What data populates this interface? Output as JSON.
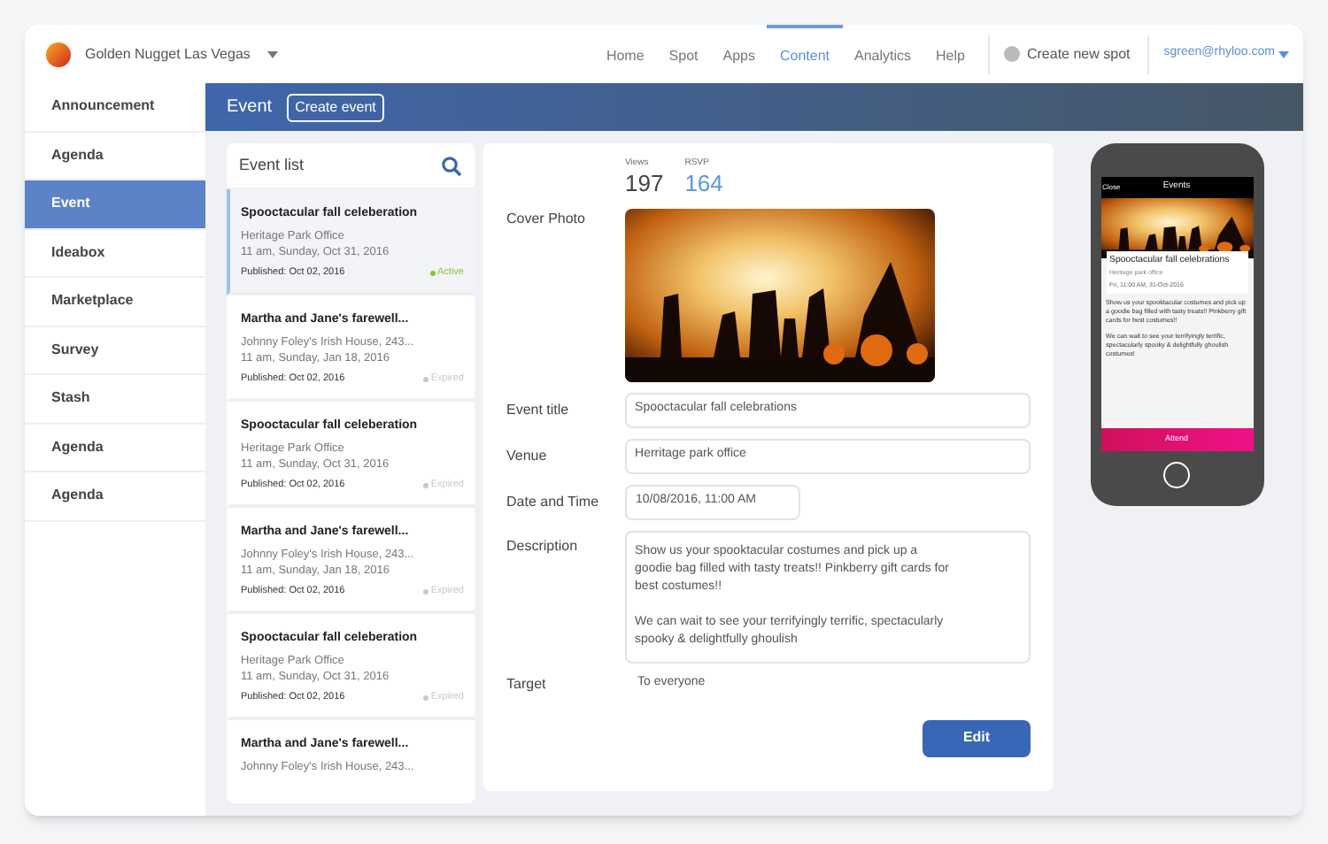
{
  "brand": {
    "name": "Golden Nugget Las Vegas"
  },
  "nav": [
    {
      "label": "Home",
      "selected": false
    },
    {
      "label": "Spot",
      "selected": false
    },
    {
      "label": "Apps",
      "selected": false
    },
    {
      "label": "Content",
      "selected": true
    },
    {
      "label": "Analytics",
      "selected": false
    },
    {
      "label": "Help",
      "selected": false
    }
  ],
  "create_spot": "Create new spot",
  "user": "sgreen@rhyloo.com",
  "sidebar": {
    "items": [
      {
        "label": "Announcement",
        "selected": false
      },
      {
        "label": "Agenda",
        "selected": false
      },
      {
        "label": "Event",
        "selected": true
      },
      {
        "label": "Ideabox",
        "selected": false
      },
      {
        "label": "Marketplace",
        "selected": false
      },
      {
        "label": "Survey",
        "selected": false
      },
      {
        "label": "Stash",
        "selected": false
      },
      {
        "label": "Agenda",
        "selected": false
      },
      {
        "label": "Agenda",
        "selected": false
      }
    ]
  },
  "header": {
    "title": "Event",
    "button": "Create event"
  },
  "event_list": {
    "title": "Event list",
    "items": [
      {
        "title": "Spooctacular fall celeberation",
        "venue": "Heritage Park Office",
        "time": "11 am, Sunday, Oct 31, 2016",
        "published": "Published: Oct 02, 2016",
        "status": "Active",
        "active": true,
        "selected": true
      },
      {
        "title": "Martha and Jane's farewell...",
        "venue": "Johnny Foley's Irish House, 243...",
        "time": "11 am, Sunday, Jan 18, 2016",
        "published": "Published: Oct 02, 2016",
        "status": "Expired",
        "active": false,
        "selected": false
      },
      {
        "title": "Spooctacular fall celeberation",
        "venue": "Heritage Park Office",
        "time": "11 am, Sunday, Oct 31, 2016",
        "published": "Published: Oct 02, 2016",
        "status": "Expired",
        "active": false,
        "selected": false
      },
      {
        "title": "Martha and Jane's farewell...",
        "venue": "Johnny Foley's Irish House, 243...",
        "time": "11 am, Sunday, Jan 18, 2016",
        "published": "Published: Oct 02, 2016",
        "status": "Expired",
        "active": false,
        "selected": false
      },
      {
        "title": "Spooctacular fall celeberation",
        "venue": "Heritage Park Office",
        "time": "11 am, Sunday, Oct 31, 2016",
        "published": "Published: Oct 02, 2016",
        "status": "Expired",
        "active": false,
        "selected": false
      },
      {
        "title": "Martha and Jane's farewell...",
        "venue": "Johnny Foley's Irish House, 243..."
      }
    ]
  },
  "detail": {
    "stats": [
      {
        "label": "Views",
        "value": "197",
        "kind": "plain"
      },
      {
        "label": "RSVP",
        "value": "164",
        "kind": "accent"
      }
    ],
    "cover_label": "Cover Photo",
    "fields": [
      {
        "label": "Event title",
        "value": "Spooctacular fall celebrations",
        "kind": "wide"
      },
      {
        "label": "Venue",
        "value": "Herritage park office",
        "kind": "wide"
      },
      {
        "label": "Date and Time",
        "value": "10/08/2016, 11:00 AM",
        "kind": "short"
      }
    ],
    "description": {
      "label": "Description",
      "paragraphs": [
        "Show us your spooktacular costumes and pick up a goodie bag filled with tasty treats!! Pinkberry gift cards for best costumes!!",
        "We can wait to see your terrifyingly terrific, spectacularly spooky & delightfully ghoulish"
      ]
    },
    "target": {
      "label": "Target",
      "value": "To everyone"
    },
    "edit": "Edit"
  },
  "phone": {
    "close": "Close",
    "title": "Events",
    "event_title": "Spooctacular fall celebrations",
    "venue": "Heritage park office",
    "time": "Fri, 11:00 AM, 31-Oct-2016",
    "paragraphs": [
      "Show us your spooktacular costumes and pick up a goodie bag filled with tasty treats!! Pinkberry gift cards for best costumes!!",
      "We can wait to see your terrifyingly terrific, spectacularly spooky & delightfully ghoulish costumes!"
    ],
    "attend": "Attend"
  }
}
